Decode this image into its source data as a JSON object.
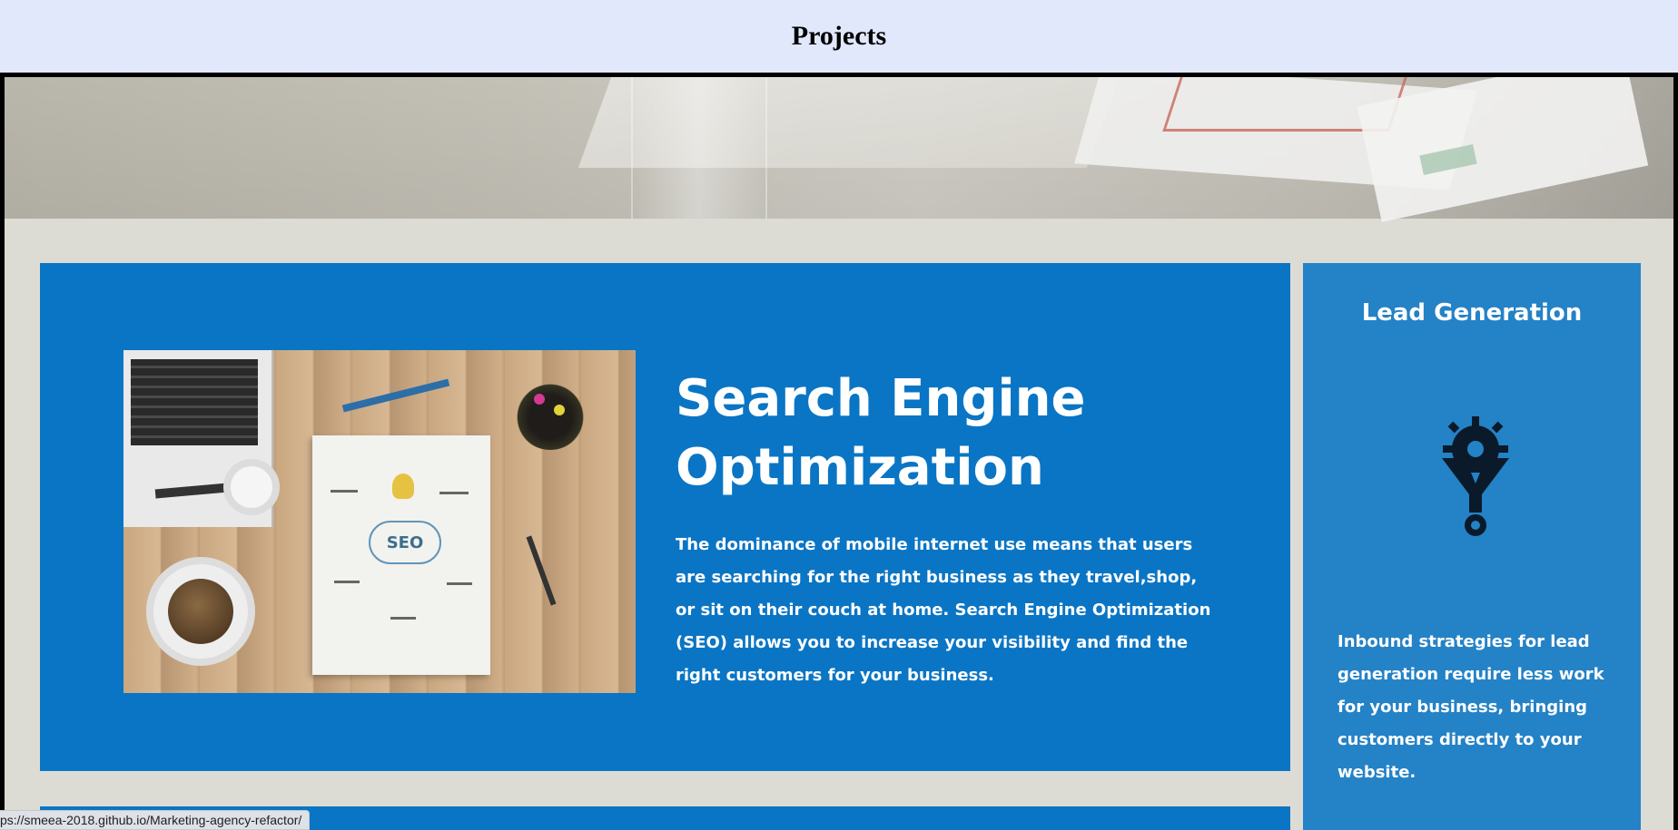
{
  "page": {
    "title": "Projects"
  },
  "seo_card": {
    "title": "Search Engine Optimization",
    "text": "The dominance of mobile internet use means that users are searching for the right business as they travel,shop, or sit on their couch at home. Search Engine Optimization (SEO) allows you to increase your visibility and find the right customers for your business.",
    "image_label": "SEO"
  },
  "lead_card": {
    "title": "Lead Generation",
    "icon": "funnel-gear-icon",
    "text": "Inbound strategies for lead generation require less work for your business, bringing customers directly to your website."
  },
  "status_bar": {
    "url": "ps://smeea-2018.github.io/Marketing-agency-refactor/"
  },
  "colors": {
    "header_bg": "#e1e8fb",
    "seo_card_bg": "#0a75c4",
    "lead_card_bg": "#2482c6",
    "page_bg": "#dcdcd5"
  }
}
